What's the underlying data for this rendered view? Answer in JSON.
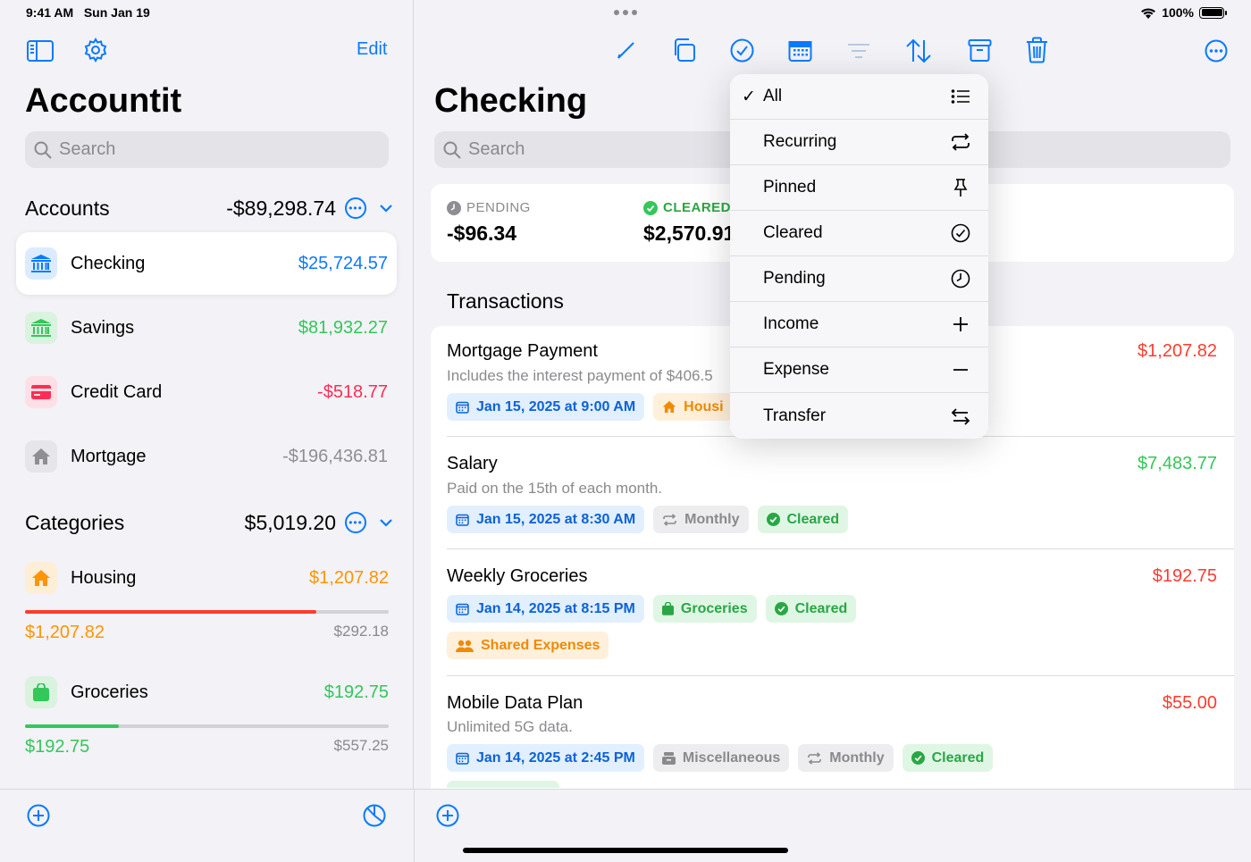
{
  "status": {
    "time": "9:41 AM",
    "date": "Sun Jan 19",
    "battery": "100%"
  },
  "sidebar": {
    "edit_label": "Edit",
    "title": "Accountit",
    "search_placeholder": "Search",
    "accounts_label": "Accounts",
    "accounts_total": "-$89,298.74",
    "accounts": [
      {
        "name": "Checking",
        "amount": "$25,724.57",
        "color": "#0a7aff",
        "icon": "bank-icon"
      },
      {
        "name": "Savings",
        "amount": "$81,932.27",
        "color": "#34c759",
        "icon": "bank-icon"
      },
      {
        "name": "Credit Card",
        "amount": "-$518.77",
        "color": "#ff2d55",
        "icon": "credit-card-icon"
      },
      {
        "name": "Mortgage",
        "amount": "-$196,436.81",
        "color": "#8e8e93",
        "icon": "house-icon"
      }
    ],
    "categories_label": "Categories",
    "categories_total": "$5,019.20",
    "categories": [
      {
        "name": "Housing",
        "amount": "$1,207.82",
        "spent": "$1,207.82",
        "remaining": "$292.18",
        "progress": 0.8,
        "color": "#ff9500",
        "bar_color": "#ff3b30"
      },
      {
        "name": "Groceries",
        "amount": "$192.75",
        "spent": "$192.75",
        "remaining": "$557.25",
        "progress": 0.257,
        "color": "#34c759",
        "bar_color": "#34c759"
      }
    ]
  },
  "main": {
    "title": "Checking",
    "search_placeholder": "Search",
    "pending_label": "PENDING",
    "pending_value": "-$96.34",
    "cleared_label": "CLEARED",
    "cleared_value": "$2,570.91",
    "transactions_label": "Transactions",
    "transactions": [
      {
        "title": "Mortgage Payment",
        "amount": "$1,207.82",
        "desc": "Includes the interest payment of $406.5",
        "date": "Jan 15, 2025 at 9:00 AM",
        "category": "Housi"
      },
      {
        "title": "Salary",
        "amount": "$7,483.77",
        "desc": "Paid on the 15th of each month.",
        "date": "Jan 15, 2025 at 8:30 AM",
        "recurrence": "Monthly",
        "status": "Cleared"
      },
      {
        "title": "Weekly Groceries",
        "amount": "$192.75",
        "date": "Jan 14, 2025 at 8:15 PM",
        "category": "Groceries",
        "status": "Cleared",
        "tag": "Shared Expenses"
      },
      {
        "title": "Mobile Data Plan",
        "amount": "$55.00",
        "desc": "Unlimited 5G data.",
        "date": "Jan 14, 2025 at 2:45 PM",
        "category": "Miscellaneous",
        "recurrence": "Monthly",
        "status": "Cleared"
      }
    ]
  },
  "filter_menu": {
    "items": [
      {
        "label": "All",
        "checked": true,
        "icon": "list-icon"
      },
      {
        "label": "Recurring",
        "icon": "repeat-icon"
      },
      {
        "label": "Pinned",
        "icon": "pin-icon"
      },
      {
        "label": "Cleared",
        "icon": "checkmark-circle-icon"
      },
      {
        "label": "Pending",
        "icon": "clock-icon"
      },
      {
        "label": "Income",
        "icon": "plus-icon"
      },
      {
        "label": "Expense",
        "icon": "minus-icon"
      },
      {
        "label": "Transfer",
        "icon": "transfer-arrows-icon"
      }
    ]
  },
  "colors": {
    "accent": "#0a7aff",
    "expense": "#ff3b30",
    "income": "#34c759",
    "pending": "#8e8e93"
  }
}
